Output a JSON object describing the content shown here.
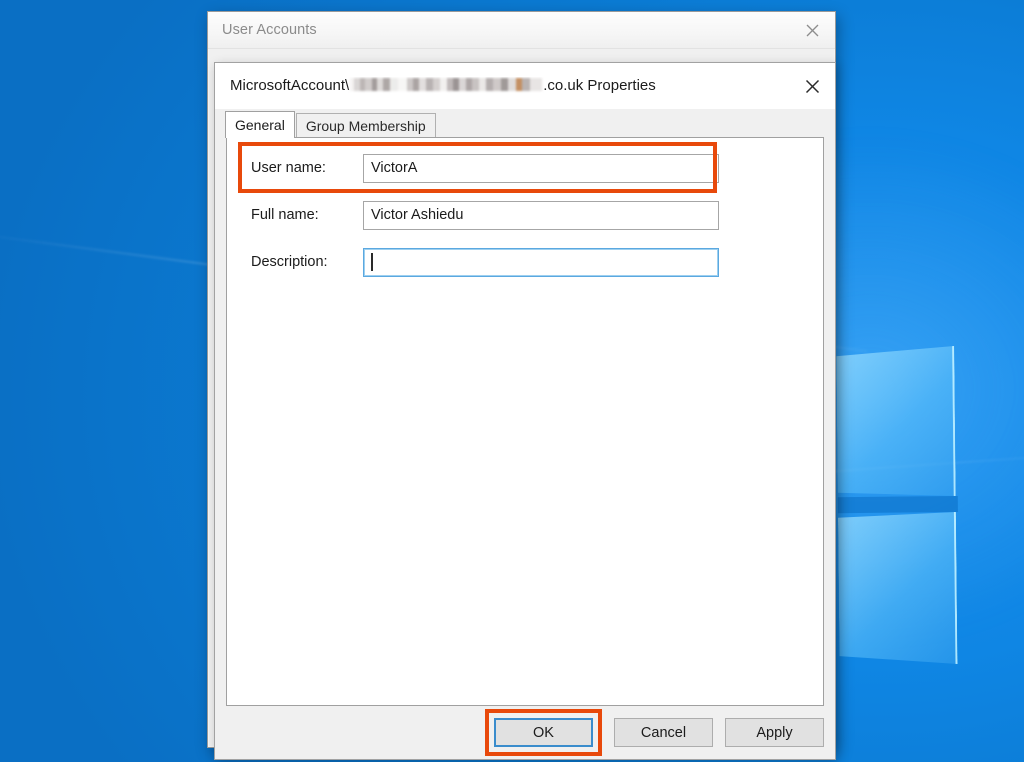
{
  "desktop": {
    "wallpaper_color": "#0c86d8",
    "logo_name": "windows-logo"
  },
  "outer_window": {
    "title": "User Accounts",
    "close_label": "✕"
  },
  "dialog": {
    "title_prefix": "MicrosoftAccount\\",
    "title_suffix": ".co.uk Properties",
    "redacted_note": "",
    "close_label": "✕",
    "tabs": [
      {
        "label": "General",
        "active": true
      },
      {
        "label": "Group Membership",
        "active": false
      }
    ],
    "fields": [
      {
        "label": "User name:",
        "value": "VictorA",
        "placeholder": "",
        "focused": false,
        "highlighted": true
      },
      {
        "label": "Full name:",
        "value": "Victor Ashiedu",
        "placeholder": "",
        "focused": false,
        "highlighted": false
      },
      {
        "label": "Description:",
        "value": "",
        "placeholder": "",
        "focused": true,
        "highlighted": false
      }
    ],
    "buttons": [
      {
        "label": "OK",
        "default": true,
        "highlighted": true
      },
      {
        "label": "Cancel",
        "default": false,
        "highlighted": false
      },
      {
        "label": "Apply",
        "default": false,
        "highlighted": false
      }
    ]
  },
  "annotation": {
    "highlight_color": "#e8490b",
    "focus_color": "#5ba8e0"
  }
}
